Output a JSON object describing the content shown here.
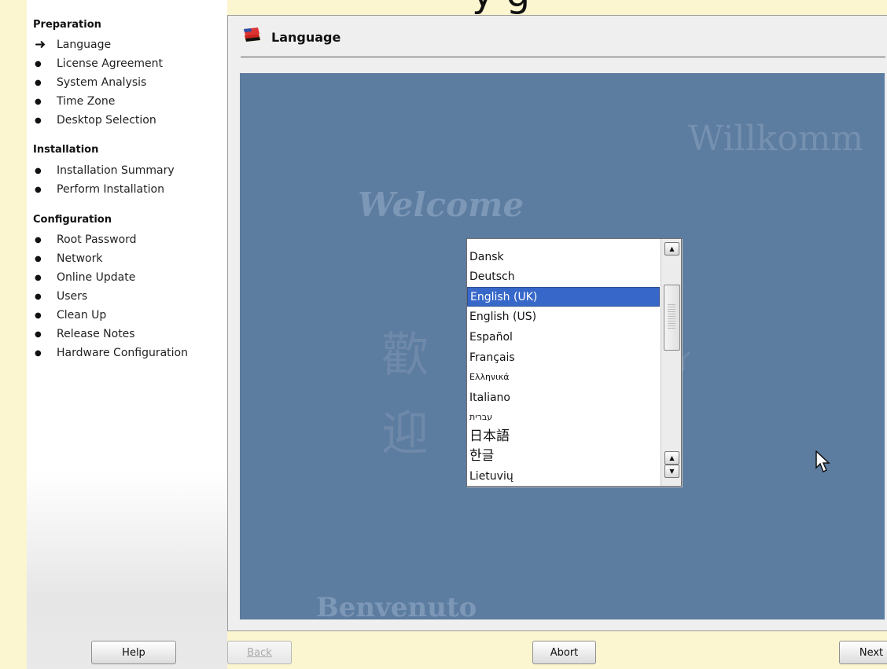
{
  "sidebar": {
    "sections": [
      {
        "title": "Preparation",
        "items": [
          "Language",
          "License Agreement",
          "System Analysis",
          "Time Zone",
          "Desktop Selection"
        ]
      },
      {
        "title": "Installation",
        "items": [
          "Installation Summary",
          "Perform Installation"
        ]
      },
      {
        "title": "Configuration",
        "items": [
          "Root Password",
          "Network",
          "Online Update",
          "Users",
          "Clean Up",
          "Release Notes",
          "Hardware Configuration"
        ]
      }
    ],
    "current_step": "Language",
    "help_label": "Help"
  },
  "panel": {
    "title": "Language",
    "icon": "flag-icon",
    "background_words": {
      "welcome": "Welcome",
      "willkommen": "Willkomm",
      "benvenuto": "Benvenuto",
      "huan": "歡",
      "ying": "迎",
      "ai": "ィ"
    },
    "language_list": {
      "items": [
        "Dansk",
        "Deutsch",
        "English (UK)",
        "English (US)",
        "Español",
        "Français",
        "Ελληνικά",
        "Italiano",
        "עברית",
        "日本語",
        "한글",
        "Lietuvių"
      ],
      "selected": "English (UK)"
    }
  },
  "buttons": {
    "back": "Back",
    "abort": "Abort",
    "next": "Next"
  },
  "colors": {
    "welcome_bg": "#5c7ca0",
    "selection": "#3768c9",
    "desktop": "#fbf6cf"
  }
}
